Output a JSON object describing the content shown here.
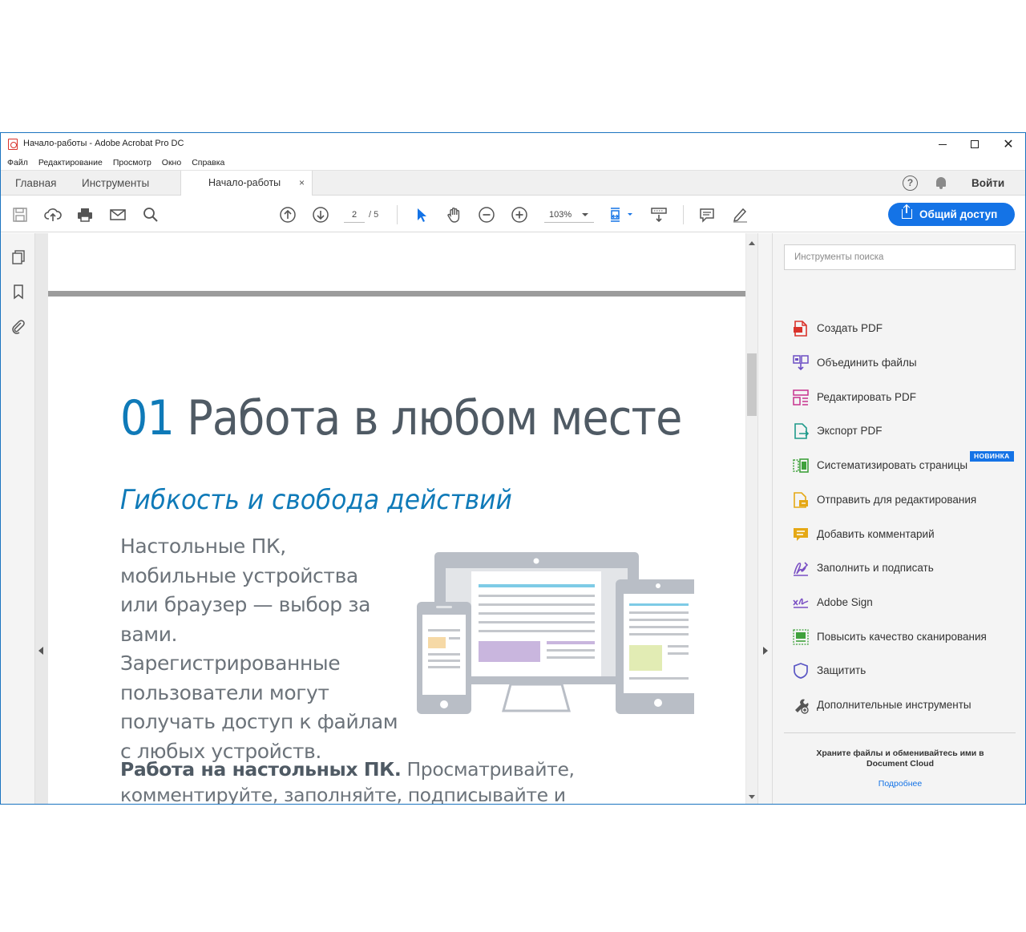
{
  "window": {
    "title": "Начало-работы - Adobe Acrobat Pro DC",
    "minimize": "",
    "maximize": "",
    "close": "✕"
  },
  "menu": [
    "Файл",
    "Редактирование",
    "Просмотр",
    "Окно",
    "Справка"
  ],
  "tabs": {
    "home": "Главная",
    "tools": "Инструменты",
    "document": "Начало-работы",
    "document_close": "×",
    "help": "?",
    "sign_in": "Войти"
  },
  "toolbar": {
    "page_current": "2",
    "page_total": "/ 5",
    "zoom": "103%",
    "share_label": "Общий доступ"
  },
  "document": {
    "heading_number": "01",
    "heading_text": " Работа в любом месте",
    "subheading": "Гибкость и свобода действий",
    "body": "Настольные ПК, мобильные устройства или браузер — выбор за вами. Зарегистрированные пользователи могут получать доступ к файлам с любых устройств.",
    "desktop_bold": "Работа на настольных ПК.",
    "desktop_text": " Просматривайте, комментируйте, заполняйте, подписывайте и отправляйте PDF в бесплатном"
  },
  "right_panel": {
    "search_placeholder": "Инструменты поиска",
    "tools": [
      {
        "label": "Создать PDF",
        "icon": "create-pdf-icon",
        "color": "#d9332b"
      },
      {
        "label": "Объединить файлы",
        "icon": "combine-files-icon",
        "color": "#6d4fc4"
      },
      {
        "label": "Редактировать PDF",
        "icon": "edit-pdf-icon",
        "color": "#c6338e"
      },
      {
        "label": "Экспорт PDF",
        "icon": "export-pdf-icon",
        "color": "#1f9a8a"
      },
      {
        "label": "Систематизировать страницы",
        "icon": "organize-pages-icon",
        "color": "#3fa13c"
      },
      {
        "label": "Отправить для редактирования",
        "icon": "send-for-review-icon",
        "color": "#e5a815"
      },
      {
        "label": "Добавить комментарий",
        "icon": "comment-icon",
        "color": "#e5a815"
      },
      {
        "label": "Заполнить и подписать",
        "icon": "fill-sign-icon",
        "color": "#7a4fc4"
      },
      {
        "label": "Adobe Sign",
        "icon": "adobe-sign-icon",
        "color": "#7a4fc4"
      },
      {
        "label": "Повысить качество сканирования",
        "icon": "enhance-scan-icon",
        "color": "#3fa13c"
      },
      {
        "label": "Защитить",
        "icon": "protect-icon",
        "color": "#5a56c4"
      },
      {
        "label": "Дополнительные инструменты",
        "icon": "more-tools-icon",
        "color": "#555555"
      }
    ],
    "new_badge": "НОВИНКА",
    "cloud_text": "Храните файлы и обменивайтесь ими в Document Cloud",
    "learn_more": "Подробнее"
  }
}
